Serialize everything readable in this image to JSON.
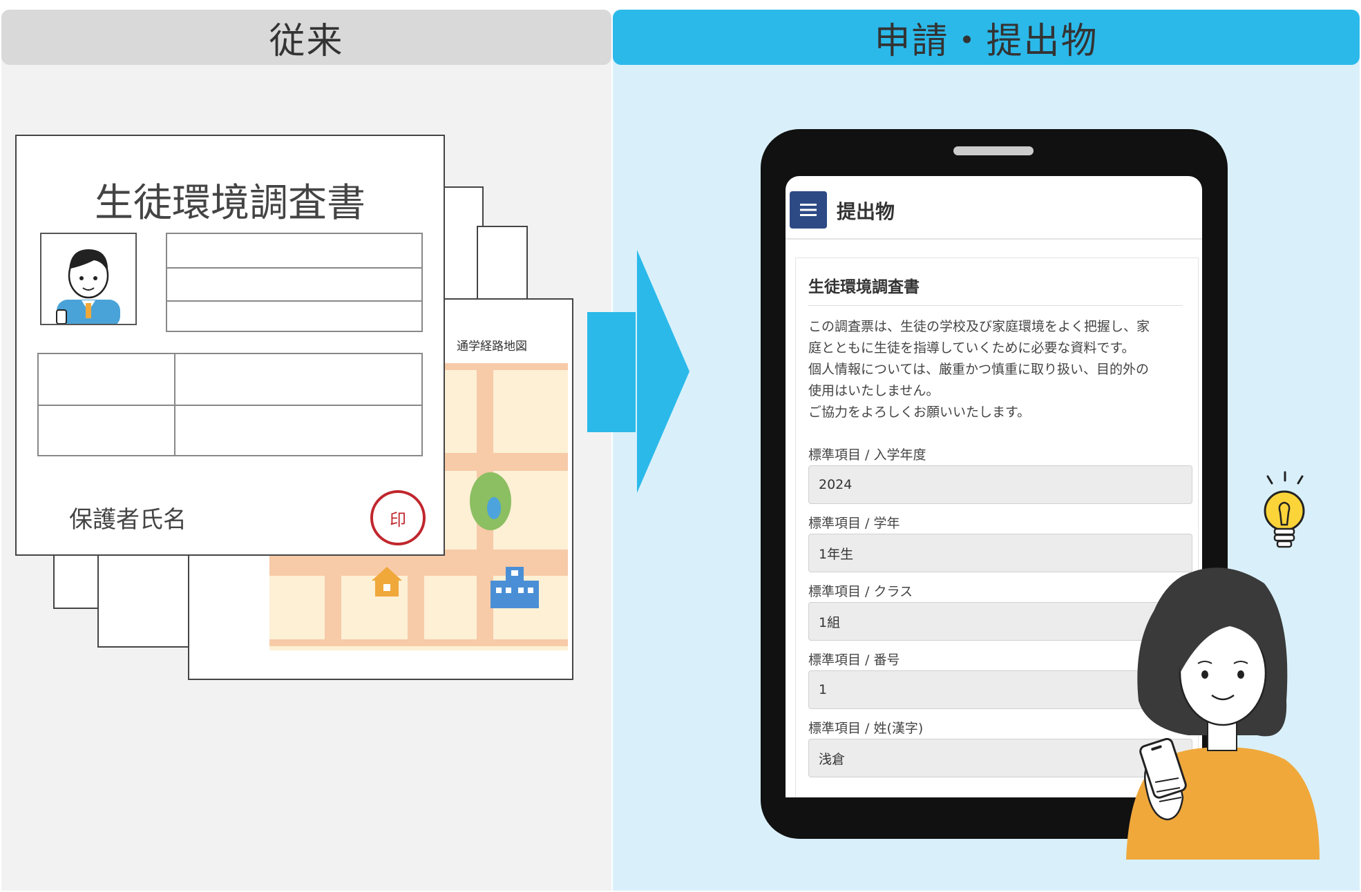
{
  "headers": {
    "left_title": "従来",
    "right_title": "申請・提出物"
  },
  "paper_form": {
    "title": "生徒環境調査書",
    "guardian_label": "保護者氏名",
    "seal_label": "印",
    "map_title": "通学経路地図"
  },
  "tablet": {
    "menu_icon": "hamburger-menu-icon",
    "app_title": "提出物",
    "form_title": "生徒環境調査書",
    "description": [
      "この調査票は、生徒の学校及び家庭環境をよく把握し、家",
      "庭とともに生徒を指導していくために必要な資料です。",
      "個人情報については、厳重かつ慎重に取り扱い、目的外の",
      "使用はいたしません。",
      "ご協力をよろしくお願いいたします。"
    ],
    "fields": [
      {
        "label": "標準項目 / 入学年度",
        "value": "2024"
      },
      {
        "label": "標準項目 / 学年",
        "value": "1年生"
      },
      {
        "label": "標準項目 / クラス",
        "value": "1組"
      },
      {
        "label": "標準項目 / 番号",
        "value": "1"
      },
      {
        "label": "標準項目 / 姓(漢字)",
        "value": "浅倉"
      }
    ]
  },
  "colors": {
    "accent_blue": "#2bb9ea",
    "seal_red": "#c0272d",
    "menu_navy": "#2d4a85",
    "shirt_orange": "#f0a83b"
  }
}
